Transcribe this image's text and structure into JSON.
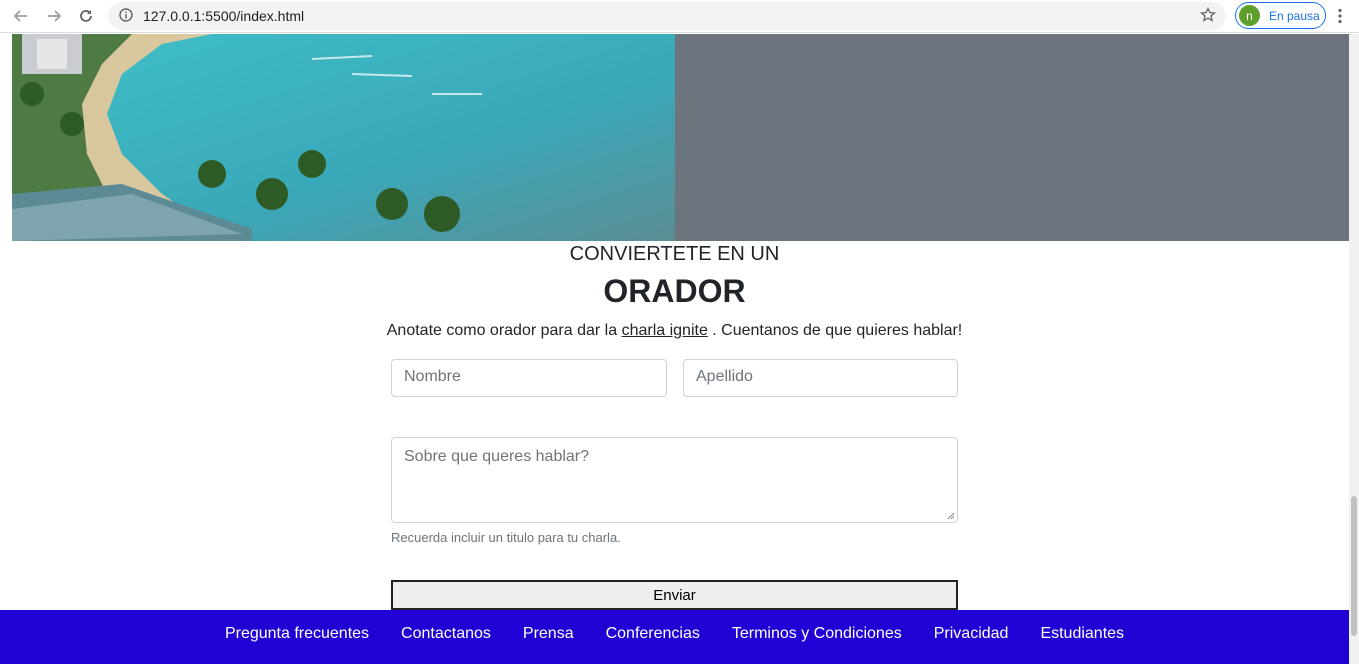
{
  "browser": {
    "url": "127.0.0.1:5500/index.html",
    "profile_initial": "n",
    "profile_status": "En pausa"
  },
  "section": {
    "kicker": "CONVIERTETE EN UN",
    "title": "ORADOR",
    "lead_prefix": "Anotate como orador para dar la ",
    "lead_link": "charla ignite",
    "lead_suffix": " . Cuentanos de que quieres hablar!"
  },
  "form": {
    "first_name_placeholder": "Nombre",
    "last_name_placeholder": "Apellido",
    "topic_placeholder": "Sobre que queres hablar?",
    "help_text": "Recuerda incluir un titulo para tu charla.",
    "submit_label": "Enviar"
  },
  "footer": {
    "links": [
      "Pregunta frecuentes",
      "Contactanos",
      "Prensa",
      "Conferencias",
      "Terminos y Condiciones",
      "Privacidad",
      "Estudiantes"
    ]
  }
}
